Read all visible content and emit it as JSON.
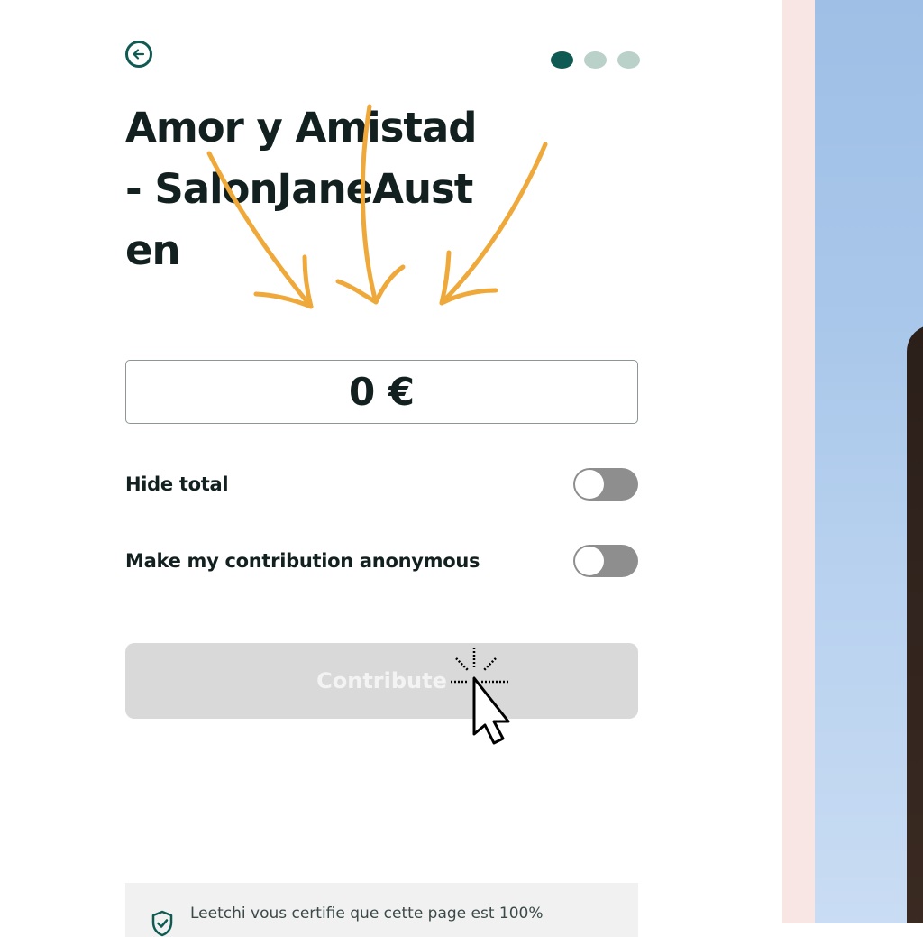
{
  "page": {
    "title": "Amor y Amistad - SalonJaneAusten",
    "amount": "0 €",
    "steps": {
      "total": 3,
      "current": 1
    },
    "colors": {
      "accent": "#0f5a52",
      "step_active": "#0f5a52",
      "step_inactive": "#b9d1c9",
      "annotation_arrow": "#efa83a"
    },
    "icons": {
      "back": "arrow-left-circle-icon",
      "notice": "shield-icon",
      "cursor": "pointer-cursor-icon"
    }
  },
  "toggles": [
    {
      "label": "Hide total",
      "on": false
    },
    {
      "label": "Make my contribution anonymous",
      "on": false
    }
  ],
  "contribute": {
    "label": "Contribute",
    "enabled": false
  },
  "notice": {
    "text": "Leetchi vous certifie que cette page est 100%"
  }
}
